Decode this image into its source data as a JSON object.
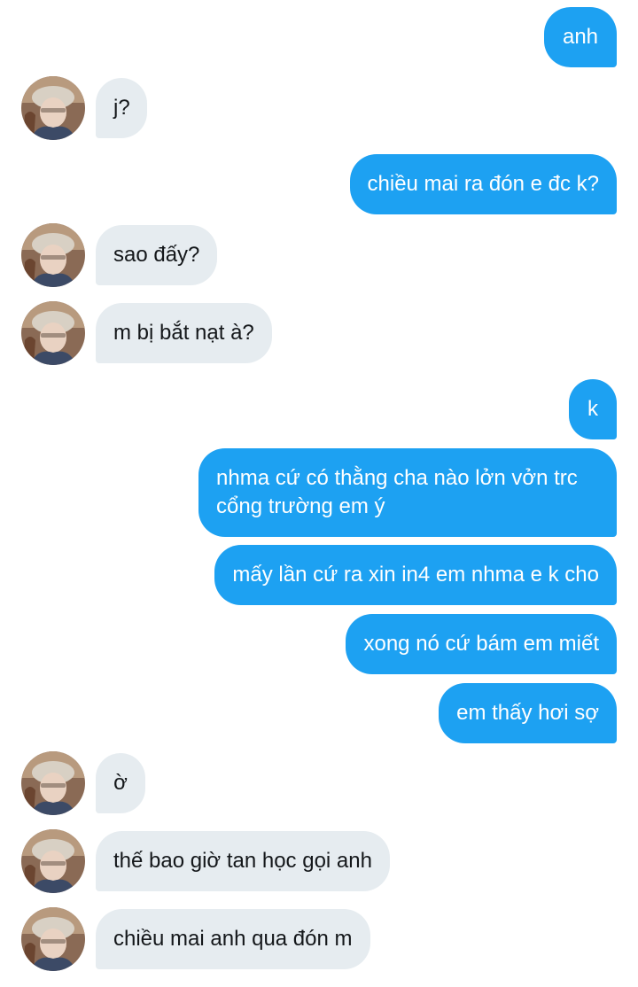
{
  "messages": [
    {
      "sender": "me",
      "text": "anh"
    },
    {
      "sender": "them",
      "text": "j?"
    },
    {
      "sender": "me",
      "text": "chiều mai ra đón e đc k?"
    },
    {
      "sender": "them",
      "text": "sao đấy?"
    },
    {
      "sender": "them",
      "text": "m bị bắt nạt à?"
    },
    {
      "sender": "me",
      "text": "k"
    },
    {
      "sender": "me",
      "text": "nhma cứ có thằng cha nào lởn vởn trc cổng trường em ý"
    },
    {
      "sender": "me",
      "text": "mấy lần cứ ra xin in4 em nhma e k cho"
    },
    {
      "sender": "me",
      "text": "xong nó cứ bám em miết"
    },
    {
      "sender": "me",
      "text": "em thấy hơi sợ"
    },
    {
      "sender": "them",
      "text": "ờ"
    },
    {
      "sender": "them",
      "text": "thế bao giờ tan học gọi anh"
    },
    {
      "sender": "them",
      "text": "chiều mai anh qua đón m"
    }
  ],
  "colors": {
    "outgoing_bubble": "#1da1f2",
    "incoming_bubble": "#e6ecf0",
    "outgoing_text": "#ffffff",
    "incoming_text": "#14171a"
  },
  "avatar": {
    "icon": "user-avatar-photo"
  }
}
